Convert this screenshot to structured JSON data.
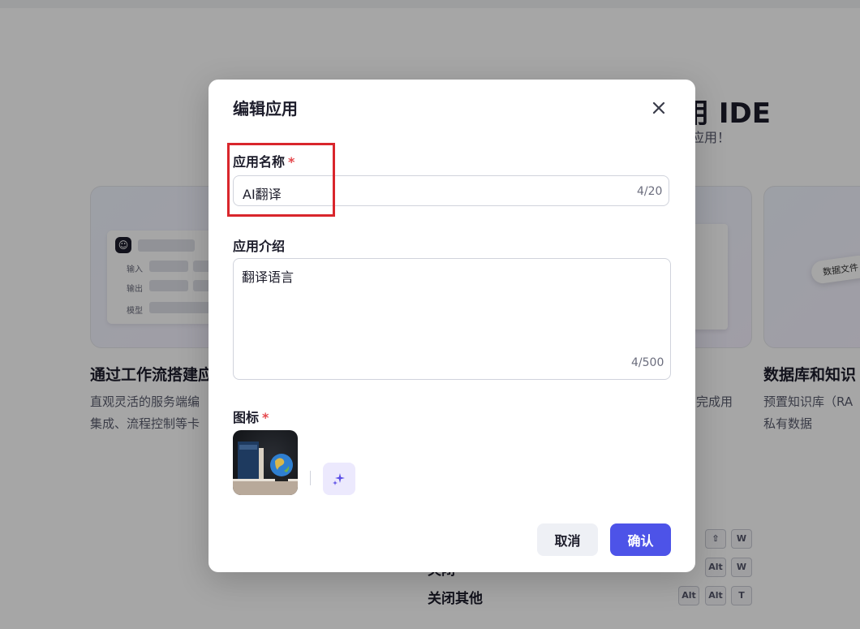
{
  "background": {
    "heading": "用 IDE",
    "subheading": "应用！",
    "cards": [
      {
        "title": "通过工作流搭建应",
        "desc_line1": "直观灵活的服务端编",
        "desc_line2": "集成、流程控制等卡",
        "mini_labels": [
          "输入",
          "输出",
          "模型"
        ]
      },
      {
        "title": "",
        "desc_line1": "完成用",
        "desc_line2": ""
      },
      {
        "title": "数据库和知识",
        "desc_line1": "预置知识库（RA",
        "desc_line2": "私有数据",
        "pill": "数据文件"
      }
    ],
    "shortcuts": [
      {
        "label": "",
        "keys": [
          "⇧",
          "W"
        ]
      },
      {
        "label": "关闭",
        "keys": [
          "Alt",
          "W"
        ]
      },
      {
        "label": "关闭其他",
        "keys": [
          "Alt",
          "Alt",
          "T"
        ]
      }
    ]
  },
  "modal": {
    "title": "编辑应用",
    "name_label": "应用名称",
    "required_mark": "*",
    "name_value": "AI翻译",
    "name_counter": "4/20",
    "desc_label": "应用介绍",
    "desc_value": "翻译语言",
    "desc_counter": "4/500",
    "icon_label": "图标",
    "cancel_label": "取消",
    "confirm_label": "确认"
  },
  "colors": {
    "accent": "#4d53e8",
    "required": "#e5484d",
    "highlight": "#d9262c"
  }
}
